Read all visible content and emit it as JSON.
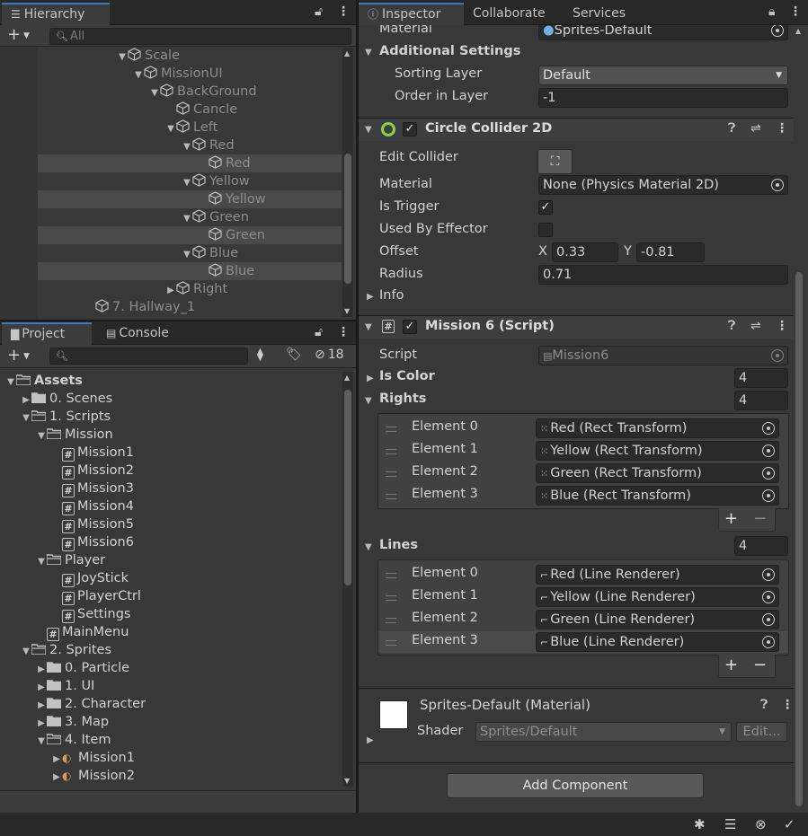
{
  "hierarchy": {
    "tab_label": "Hierarchy",
    "search_placeholder": "All",
    "rows": [
      {
        "label": "Scale",
        "indent": 0,
        "arrow": "down",
        "selected": false
      },
      {
        "label": "MissionUI",
        "indent": 1,
        "arrow": "down",
        "selected": false
      },
      {
        "label": "BackGround",
        "indent": 2,
        "arrow": "down",
        "selected": false
      },
      {
        "label": "Cancle",
        "indent": 3,
        "arrow": "",
        "selected": false
      },
      {
        "label": "Left",
        "indent": 3,
        "arrow": "down",
        "selected": false
      },
      {
        "label": "Red",
        "indent": 4,
        "arrow": "down",
        "selected": false
      },
      {
        "label": "Red",
        "indent": 5,
        "arrow": "",
        "selected": true
      },
      {
        "label": "Yellow",
        "indent": 4,
        "arrow": "down",
        "selected": false
      },
      {
        "label": "Yellow",
        "indent": 5,
        "arrow": "",
        "selected": true
      },
      {
        "label": "Green",
        "indent": 4,
        "arrow": "down",
        "selected": false
      },
      {
        "label": "Green",
        "indent": 5,
        "arrow": "",
        "selected": true
      },
      {
        "label": "Blue",
        "indent": 4,
        "arrow": "down",
        "selected": false
      },
      {
        "label": "Blue",
        "indent": 5,
        "arrow": "",
        "selected": true
      },
      {
        "label": "Right",
        "indent": 3,
        "arrow": "right",
        "selected": false
      },
      {
        "label": "7. Hallway_1",
        "indent": -2,
        "arrow": "",
        "selected": false
      }
    ]
  },
  "project": {
    "tab_project": "Project",
    "tab_console": "Console",
    "hidden_count": "18",
    "rows": [
      {
        "label": "Assets",
        "indent": 0,
        "arrow": "down",
        "icon": "folder-open",
        "bold": true
      },
      {
        "label": "0. Scenes",
        "indent": 1,
        "arrow": "right",
        "icon": "folder"
      },
      {
        "label": "1. Scripts",
        "indent": 1,
        "arrow": "down",
        "icon": "folder-open"
      },
      {
        "label": "Mission",
        "indent": 2,
        "arrow": "down",
        "icon": "folder-open"
      },
      {
        "label": "Mission1",
        "indent": 3,
        "arrow": "",
        "icon": "script"
      },
      {
        "label": "Mission2",
        "indent": 3,
        "arrow": "",
        "icon": "script"
      },
      {
        "label": "Mission3",
        "indent": 3,
        "arrow": "",
        "icon": "script"
      },
      {
        "label": "Mission4",
        "indent": 3,
        "arrow": "",
        "icon": "script"
      },
      {
        "label": "Mission5",
        "indent": 3,
        "arrow": "",
        "icon": "script"
      },
      {
        "label": "Mission6",
        "indent": 3,
        "arrow": "",
        "icon": "script"
      },
      {
        "label": "Player",
        "indent": 2,
        "arrow": "down",
        "icon": "folder-open"
      },
      {
        "label": "JoyStick",
        "indent": 3,
        "arrow": "",
        "icon": "script"
      },
      {
        "label": "PlayerCtrl",
        "indent": 3,
        "arrow": "",
        "icon": "script"
      },
      {
        "label": "Settings",
        "indent": 3,
        "arrow": "",
        "icon": "script"
      },
      {
        "label": "MainMenu",
        "indent": 2,
        "arrow": "",
        "icon": "script"
      },
      {
        "label": "2. Sprites",
        "indent": 1,
        "arrow": "down",
        "icon": "folder-open"
      },
      {
        "label": "0. Particle",
        "indent": 2,
        "arrow": "right",
        "icon": "folder"
      },
      {
        "label": "1. UI",
        "indent": 2,
        "arrow": "right",
        "icon": "folder"
      },
      {
        "label": "2. Character",
        "indent": 2,
        "arrow": "right",
        "icon": "folder"
      },
      {
        "label": "3. Map",
        "indent": 2,
        "arrow": "right",
        "icon": "folder"
      },
      {
        "label": "4. Item",
        "indent": 2,
        "arrow": "down",
        "icon": "folder-open"
      },
      {
        "label": "Mission1",
        "indent": 3,
        "arrow": "right",
        "icon": "sprite"
      },
      {
        "label": "Mission2",
        "indent": 3,
        "arrow": "right",
        "icon": "sprite"
      }
    ]
  },
  "inspector": {
    "tab_inspector": "Inspector",
    "tab_collaborate": "Collaborate",
    "tab_services": "Services",
    "material_label": "Material",
    "material_value": "Sprites-Default",
    "additional_settings": "Additional Settings",
    "sorting_layer_label": "Sorting Layer",
    "sorting_layer_value": "Default",
    "order_label": "Order in Layer",
    "order_value": "-1",
    "collider": {
      "title": "Circle Collider 2D",
      "edit_collider": "Edit Collider",
      "material_label": "Material",
      "material_value": "None (Physics Material 2D)",
      "is_trigger_label": "Is Trigger",
      "is_trigger": true,
      "used_by_effector_label": "Used By Effector",
      "used_by_effector": false,
      "offset_label": "Offset",
      "offset_x_label": "X",
      "offset_x": "0.33",
      "offset_y_label": "Y",
      "offset_y": "-0.81",
      "radius_label": "Radius",
      "radius": "0.71",
      "info_label": "Info"
    },
    "script_comp": {
      "title": "Mission 6 (Script)",
      "script_label": "Script",
      "script_value": "Mission6",
      "is_color_label": "Is Color",
      "is_color_count": "4",
      "rights_label": "Rights",
      "rights_count": "4",
      "rights": [
        {
          "label": "Element 0",
          "value": "Red (Rect Transform)"
        },
        {
          "label": "Element 1",
          "value": "Yellow (Rect Transform)"
        },
        {
          "label": "Element 2",
          "value": "Green (Rect Transform)"
        },
        {
          "label": "Element 3",
          "value": "Blue (Rect Transform)"
        }
      ],
      "lines_label": "Lines",
      "lines_count": "4",
      "lines": [
        {
          "label": "Element 0",
          "value": "Red (Line Renderer)"
        },
        {
          "label": "Element 1",
          "value": "Yellow (Line Renderer)"
        },
        {
          "label": "Element 2",
          "value": "Green (Line Renderer)"
        },
        {
          "label": "Element 3",
          "value": "Blue (Line Renderer)"
        }
      ],
      "plus": "+",
      "minus": "−"
    },
    "material_comp": {
      "title": "Sprites-Default (Material)",
      "shader_label": "Shader",
      "shader_value": "Sprites/Default",
      "edit_button": "Edit..."
    },
    "add_component": "Add Component"
  }
}
